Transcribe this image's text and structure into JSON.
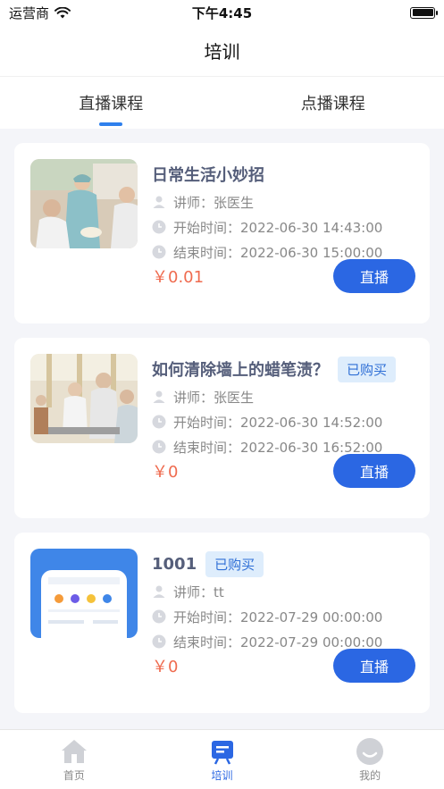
{
  "status_bar": {
    "carrier": "运营商",
    "time": "下午4:45"
  },
  "nav": {
    "title": "培训"
  },
  "tabs": [
    {
      "label": "直播课程",
      "active": true
    },
    {
      "label": "点播课程",
      "active": false
    }
  ],
  "courses": [
    {
      "title": "日常生活小妙招",
      "purchased": false,
      "badge": "",
      "teacher_label": "讲师：",
      "teacher": "张医生",
      "start_label": "开始时间：",
      "start": "2022-06-30 14:43:00",
      "end_label": "结束时间：",
      "end": "2022-06-30 15:00:00",
      "price": "￥0.01",
      "button": "直播"
    },
    {
      "title": "如何清除墙上的蜡笔渍？",
      "purchased": true,
      "badge": "已购买",
      "teacher_label": "讲师：",
      "teacher": "张医生",
      "start_label": "开始时间：",
      "start": "2022-06-30 14:52:00",
      "end_label": "结束时间：",
      "end": "2022-06-30 16:52:00",
      "price": "￥0",
      "button": "直播"
    },
    {
      "title": "1001",
      "purchased": true,
      "badge": "已购买",
      "teacher_label": "讲师：",
      "teacher": "tt",
      "start_label": "开始时间：",
      "start": "2022-07-29 00:00:00",
      "end_label": "结束时间：",
      "end": "2022-07-29 00:00:00",
      "price": "￥0",
      "button": "直播"
    }
  ],
  "tabbar": [
    {
      "label": "首页",
      "icon": "home-icon",
      "active": false
    },
    {
      "label": "培训",
      "icon": "training-icon",
      "active": true
    },
    {
      "label": "我的",
      "icon": "profile-icon",
      "active": false
    }
  ],
  "colors": {
    "accent": "#2b67e3",
    "price": "#ef6b4f",
    "badge_bg": "#deedfc"
  }
}
